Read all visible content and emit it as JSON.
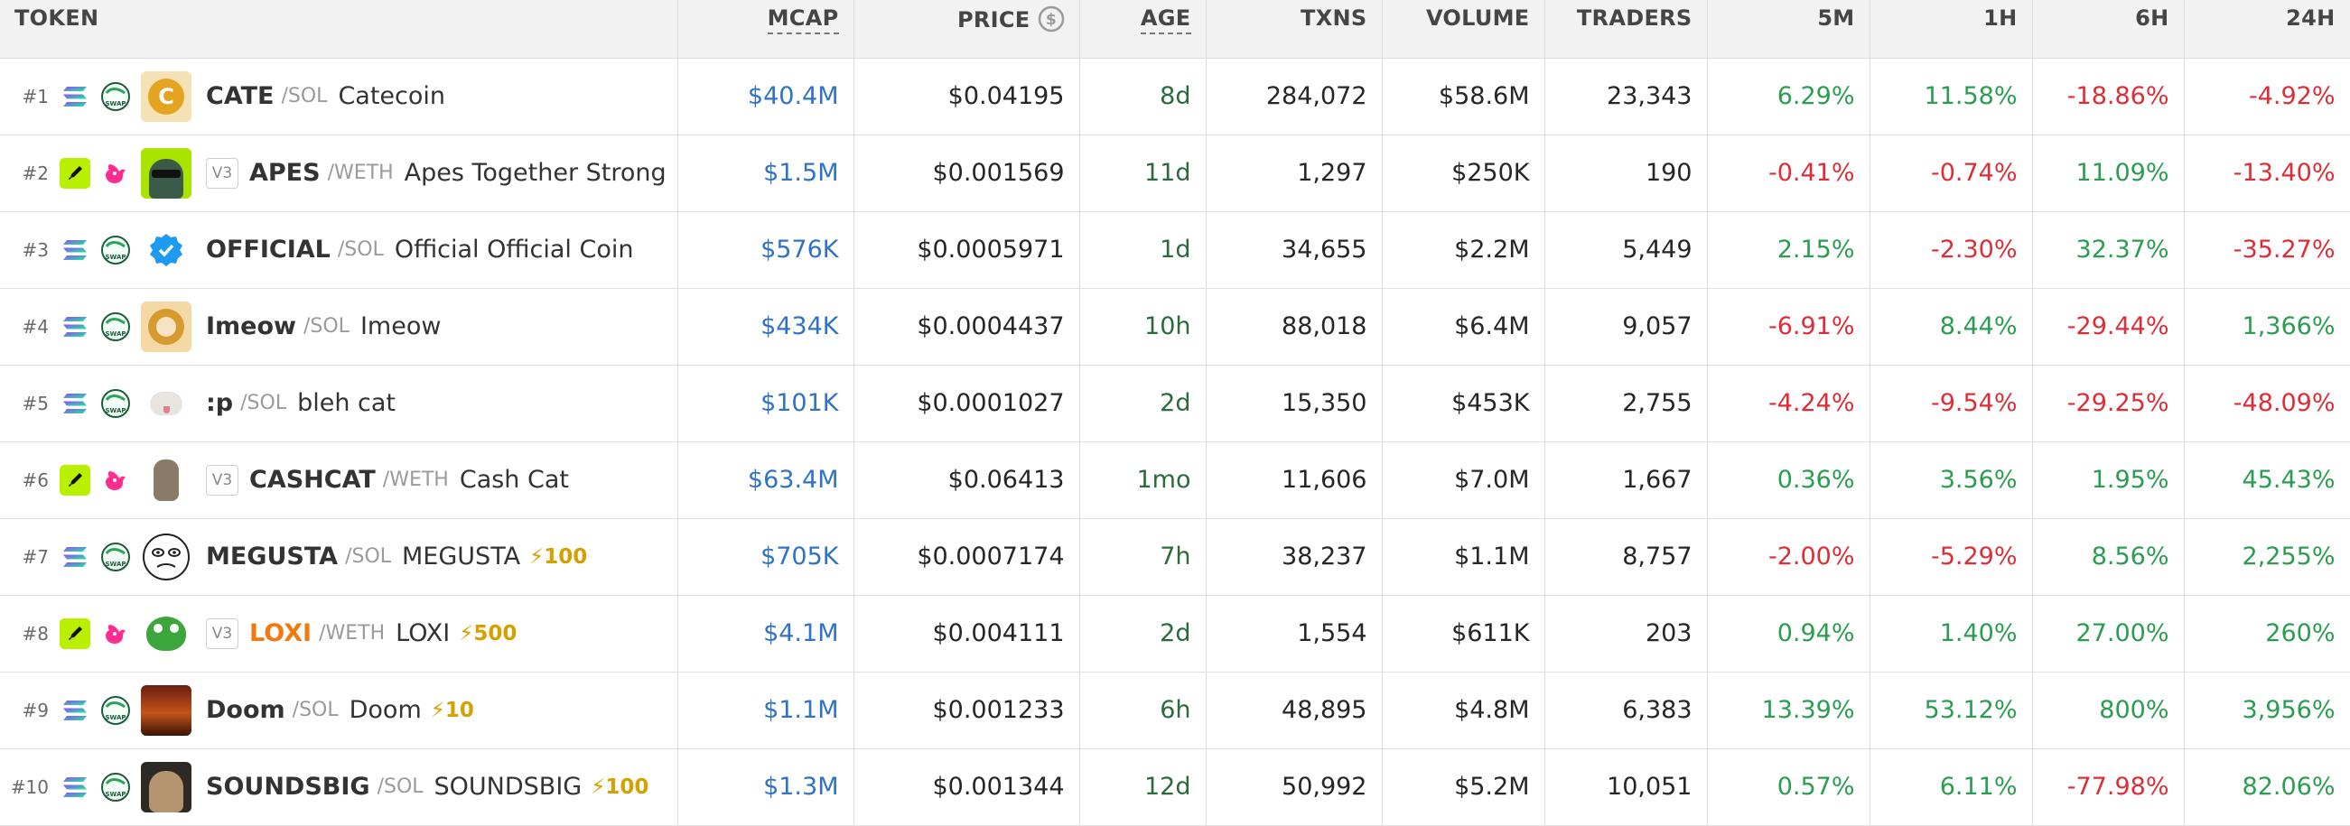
{
  "headers": {
    "token": "TOKEN",
    "mcap": "MCAP",
    "price": "PRICE",
    "age": "AGE",
    "txns": "TXNS",
    "volume": "VOLUME",
    "traders": "TRADERS",
    "m5": "5M",
    "h1": "1H",
    "h6": "6H",
    "h24": "24H"
  },
  "colors": {
    "positive": "#2a9d50",
    "negative": "#dd2d36",
    "mcap_blue": "#2f72c6",
    "age_green": "#2b6a3b",
    "boost_gold": "#d6a000"
  },
  "rows": [
    {
      "rank": "#1",
      "chain": "solana-icon",
      "dex": "swap-icon",
      "logo": "catecoin-logo",
      "v3": "",
      "symbol": "CATE",
      "pair": "/SOL",
      "name": "Catecoin",
      "boost": "",
      "mcap": "$40.4M",
      "price": "$0.04195",
      "age": "8d",
      "txns": "284,072",
      "volume": "$58.6M",
      "traders": "23,343",
      "m5": "6.29%",
      "h1": "11.58%",
      "h6": "-18.86%",
      "h24": "-4.92%"
    },
    {
      "rank": "#2",
      "chain": "ethereum-icon",
      "dex": "uniswap-icon",
      "logo": "apes-logo",
      "v3": "V3",
      "symbol": "APES",
      "pair": "/WETH",
      "name": "Apes Together Strong",
      "boost": "",
      "mcap": "$1.5M",
      "price": "$0.001569",
      "age": "11d",
      "txns": "1,297",
      "volume": "$250K",
      "traders": "190",
      "m5": "-0.41%",
      "h1": "-0.74%",
      "h6": "11.09%",
      "h24": "-13.40%"
    },
    {
      "rank": "#3",
      "chain": "solana-icon",
      "dex": "swap-icon",
      "logo": "verified-badge-logo",
      "v3": "",
      "symbol": "OFFICIAL",
      "pair": "/SOL",
      "name": "Official Official Coin",
      "boost": "",
      "mcap": "$576K",
      "price": "$0.0005971",
      "age": "1d",
      "txns": "34,655",
      "volume": "$2.2M",
      "traders": "5,449",
      "m5": "2.15%",
      "h1": "-2.30%",
      "h6": "32.37%",
      "h24": "-35.27%"
    },
    {
      "rank": "#4",
      "chain": "solana-icon",
      "dex": "swap-icon",
      "logo": "imeow-logo",
      "v3": "",
      "symbol": "Imeow",
      "pair": "/SOL",
      "name": "Imeow",
      "boost": "",
      "mcap": "$434K",
      "price": "$0.0004437",
      "age": "10h",
      "txns": "88,018",
      "volume": "$6.4M",
      "traders": "9,057",
      "m5": "-6.91%",
      "h1": "8.44%",
      "h6": "-29.44%",
      "h24": "1,366%"
    },
    {
      "rank": "#5",
      "chain": "solana-icon",
      "dex": "swap-icon",
      "logo": "bleh-cat-logo",
      "v3": "",
      "symbol": ":p",
      "pair": "/SOL",
      "name": "bleh cat",
      "boost": "",
      "mcap": "$101K",
      "price": "$0.0001027",
      "age": "2d",
      "txns": "15,350",
      "volume": "$453K",
      "traders": "2,755",
      "m5": "-4.24%",
      "h1": "-9.54%",
      "h6": "-29.25%",
      "h24": "-48.09%"
    },
    {
      "rank": "#6",
      "chain": "ethereum-icon",
      "dex": "uniswap-icon",
      "logo": "cash-cat-logo",
      "v3": "V3",
      "symbol": "CASHCAT",
      "pair": "/WETH",
      "name": "Cash Cat",
      "boost": "",
      "mcap": "$63.4M",
      "price": "$0.06413",
      "age": "1mo",
      "txns": "11,606",
      "volume": "$7.0M",
      "traders": "1,667",
      "m5": "0.36%",
      "h1": "3.56%",
      "h6": "1.95%",
      "h24": "45.43%"
    },
    {
      "rank": "#7",
      "chain": "solana-icon",
      "dex": "swap-icon",
      "logo": "megusta-logo",
      "v3": "",
      "symbol": "MEGUSTA",
      "pair": "/SOL",
      "name": "MEGUSTA",
      "boost": "⚡100",
      "mcap": "$705K",
      "price": "$0.0007174",
      "age": "7h",
      "txns": "38,237",
      "volume": "$1.1M",
      "traders": "8,757",
      "m5": "-2.00%",
      "h1": "-5.29%",
      "h6": "8.56%",
      "h24": "2,255%"
    },
    {
      "rank": "#8",
      "chain": "ethereum-icon",
      "dex": "uniswap-icon",
      "logo": "loxi-logo",
      "v3": "V3",
      "symbol": "LOXI",
      "pair": "/WETH",
      "name": "LOXI",
      "boost": "⚡500",
      "mcap": "$4.1M",
      "price": "$0.004111",
      "age": "2d",
      "txns": "1,554",
      "volume": "$611K",
      "traders": "203",
      "m5": "0.94%",
      "h1": "1.40%",
      "h6": "27.00%",
      "h24": "260%"
    },
    {
      "rank": "#9",
      "chain": "solana-icon",
      "dex": "swap-icon",
      "logo": "doom-logo",
      "v3": "",
      "symbol": "Doom",
      "pair": "/SOL",
      "name": "Doom",
      "boost": "⚡10",
      "mcap": "$1.1M",
      "price": "$0.001233",
      "age": "6h",
      "txns": "48,895",
      "volume": "$4.8M",
      "traders": "6,383",
      "m5": "13.39%",
      "h1": "53.12%",
      "h6": "800%",
      "h24": "3,956%"
    },
    {
      "rank": "#10",
      "chain": "solana-icon",
      "dex": "swap-icon",
      "logo": "soundsbig-logo",
      "v3": "",
      "symbol": "SOUNDSBIG",
      "pair": "/SOL",
      "name": "SOUNDSBIG",
      "boost": "⚡100",
      "mcap": "$1.3M",
      "price": "$0.001344",
      "age": "12d",
      "txns": "50,992",
      "volume": "$5.2M",
      "traders": "10,051",
      "m5": "0.57%",
      "h1": "6.11%",
      "h6": "-77.98%",
      "h24": "82.06%"
    }
  ]
}
